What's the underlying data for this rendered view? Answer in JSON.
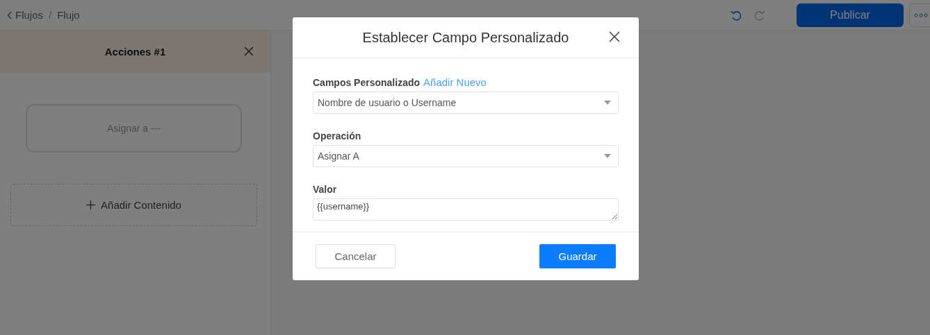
{
  "breadcrumb": {
    "back": "Flujos",
    "separator": "/",
    "current": "Flujo"
  },
  "history": [
    {
      "kind": "undo",
      "disabled": false
    },
    {
      "kind": "redo",
      "disabled": true
    }
  ],
  "publish": "Publicar",
  "panel": {
    "title": "Acciones #1",
    "actions": [
      {
        "label": "Asignar a ---"
      }
    ],
    "add_content": "Añadir Contenido"
  },
  "dialog": {
    "title": "Establecer Campo Personalizado",
    "fields": [
      {
        "kind": "select",
        "label": "Campos Personalizado",
        "link": "Añadir Nuevo",
        "value": "Nombre de usuario o Username"
      },
      {
        "kind": "select",
        "label": "Operación",
        "value": "Asignar A"
      },
      {
        "kind": "textarea",
        "label": "Valor",
        "value": "{{username}}"
      }
    ],
    "cancel": "Cancelar",
    "save": "Guardar"
  }
}
